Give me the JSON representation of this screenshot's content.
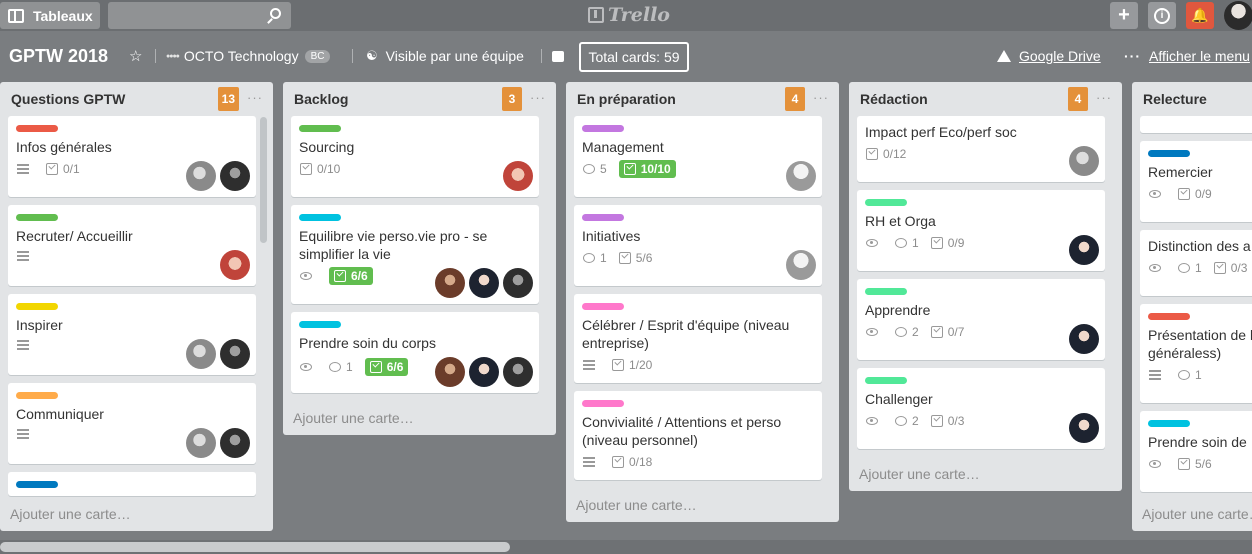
{
  "topbar": {
    "boards_label": "Tableaux",
    "logo_text": "Trello",
    "plus": "+",
    "info": "i",
    "bell": "♪"
  },
  "board": {
    "title": "GPTW 2018",
    "star": "☆",
    "team": "OCTO Technology",
    "team_badge": "BC",
    "visibility": "Visible par une équipe",
    "total_cards": "Total cards: 59",
    "google_drive": "Google Drive",
    "menu": "Afficher le menu"
  },
  "lists": [
    {
      "title": "Questions GPTW",
      "count": "13",
      "add": "Ajouter une carte…",
      "cards": [
        {
          "title": "Infos générales",
          "label_color": "#eb5a46",
          "checklist": "0/1"
        },
        {
          "title": "Recruter/ Accueillir",
          "label_color": "#61bd4f"
        },
        {
          "title": "Inspirer",
          "label_color": "#f2d600"
        },
        {
          "title": "Communiquer",
          "label_color": "#ffab4a"
        }
      ]
    },
    {
      "title": "Backlog",
      "count": "3",
      "add": "Ajouter une carte…",
      "cards": [
        {
          "title": "Sourcing",
          "label_color": "#61bd4f",
          "checklist": "0/10"
        },
        {
          "title": "Equilibre vie perso.vie pro - se simplifier la vie",
          "label_color": "#00c2e0",
          "checklist": "6/6"
        },
        {
          "title": "Prendre soin du corps",
          "label_color": "#00c2e0",
          "comments": "1",
          "checklist": "6/6"
        }
      ]
    },
    {
      "title": "En préparation",
      "count": "4",
      "add": "Ajouter une carte…",
      "cards": [
        {
          "title": "Management",
          "label_color": "#c377e0",
          "comments": "5",
          "checklist": "10/10"
        },
        {
          "title": "Initiatives",
          "label_color": "#c377e0",
          "comments": "1",
          "checklist": "5/6"
        },
        {
          "title": "Célébrer / Esprit d'équipe (niveau entreprise)",
          "label_color": "#ff78cb",
          "checklist": "1/20"
        },
        {
          "title": "Convivialité / Attentions et perso (niveau personnel)",
          "label_color": "#ff78cb",
          "checklist": "0/18"
        }
      ]
    },
    {
      "title": "Rédaction",
      "count": "4",
      "add": "Ajouter une carte…",
      "cards": [
        {
          "title": "Impact perf Eco/perf soc",
          "checklist": "0/12"
        },
        {
          "title": "RH et Orga",
          "label_color": "#51e898",
          "comments": "1",
          "checklist": "0/9"
        },
        {
          "title": "Apprendre",
          "label_color": "#51e898",
          "comments": "2",
          "checklist": "0/7"
        },
        {
          "title": "Challenger",
          "label_color": "#51e898",
          "comments": "2",
          "checklist": "0/3"
        }
      ]
    },
    {
      "title": "Relecture",
      "add": "Ajouter une carte…",
      "cards": [
        {
          "title": "Remercier",
          "label_color": "#0079bf",
          "checklist": "0/9"
        },
        {
          "title": "Distinction des a",
          "comments": "1",
          "checklist": "0/3"
        },
        {
          "title": "Présentation de l généraless)",
          "label_color": "#eb5a46",
          "comments": "1"
        },
        {
          "title": "Prendre soin de",
          "label_color": "#00c2e0",
          "checklist": "5/6"
        }
      ]
    }
  ]
}
